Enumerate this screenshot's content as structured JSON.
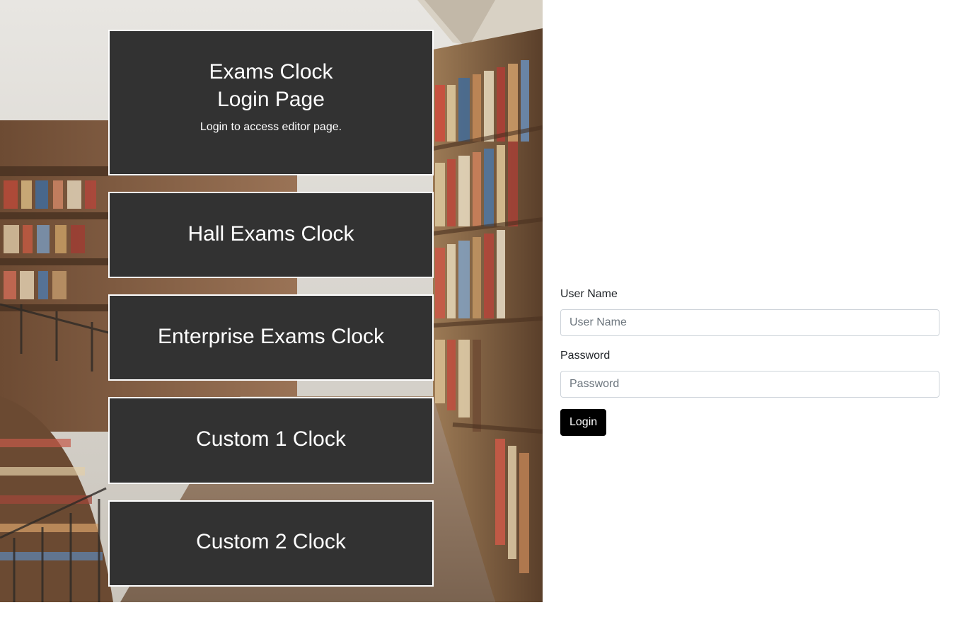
{
  "hero_card": {
    "title_line1": "Exams Clock",
    "title_line2": "Login Page",
    "subtitle": "Login to access editor page."
  },
  "clock_links": [
    {
      "label": "Hall Exams Clock"
    },
    {
      "label": "Enterprise Exams Clock"
    },
    {
      "label": "Custom 1 Clock"
    },
    {
      "label": "Custom 2 Clock"
    }
  ],
  "login_form": {
    "username_label": "User Name",
    "username_placeholder": "User Name",
    "username_value": "",
    "password_label": "Password",
    "password_placeholder": "Password",
    "password_value": "",
    "submit_label": "Login"
  },
  "colors": {
    "card_background": "#323232",
    "card_border": "#ffffff",
    "button_background": "#000000",
    "button_text": "#ffffff"
  }
}
